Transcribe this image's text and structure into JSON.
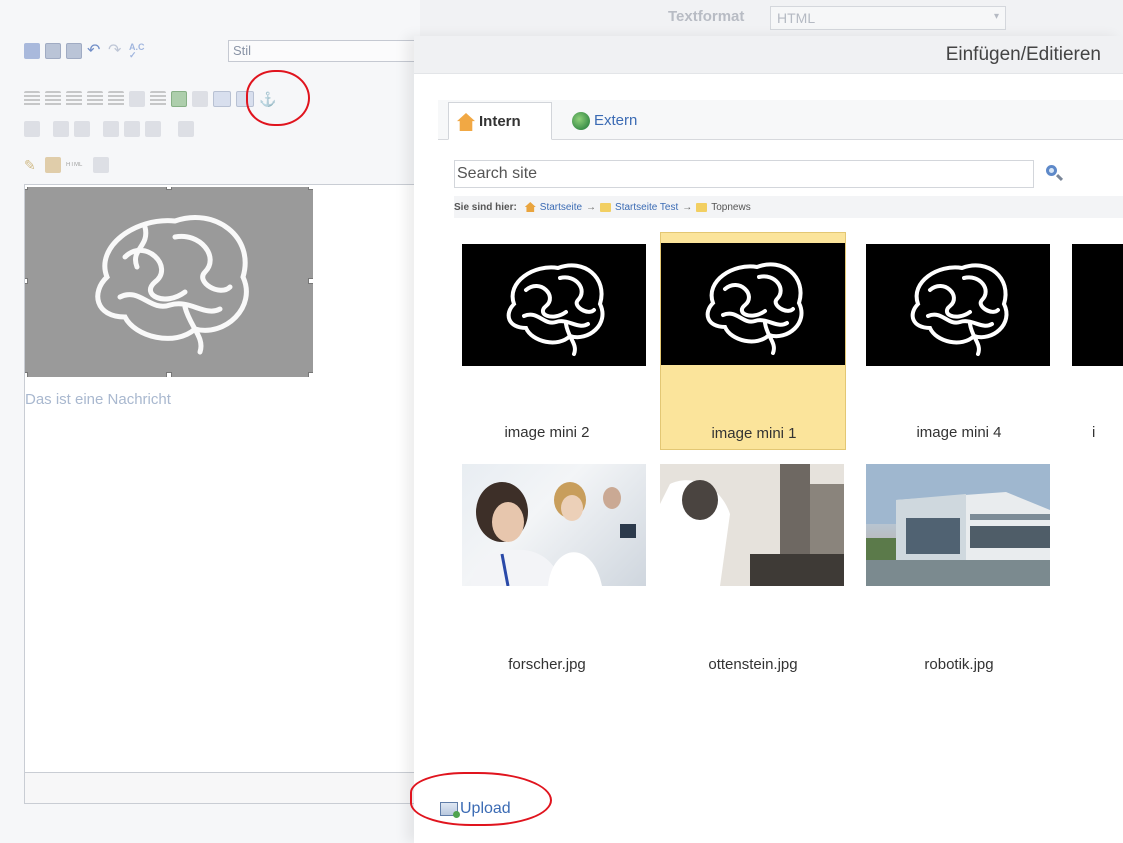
{
  "editor": {
    "style_select": {
      "value": "Stil"
    },
    "toolbar_icons": [
      "save-icon",
      "paste-text-icon",
      "paste-word-icon",
      "undo-icon",
      "redo-icon",
      "spellcheck-icon",
      "align-left-icon",
      "justify-icon",
      "bulleted-list-icon",
      "numbered-list-icon",
      "indent-icon",
      "outdent-icon",
      "blockquote-icon",
      "insert-image-icon",
      "flash-icon",
      "link-icon",
      "unlink-icon",
      "anchor-icon",
      "edit-icon",
      "table-icon",
      "subscript-icon",
      "superscript-icon",
      "spell-icon",
      "html-source-icon",
      "fullscreen-icon"
    ],
    "html_badge": "HTML",
    "content_caption": "Das ist eine Nachricht"
  },
  "textformat": {
    "label": "Textformat",
    "value": "HTML"
  },
  "dialog": {
    "title": "Einfügen/Editieren",
    "tabs": [
      {
        "label": "Intern",
        "icon": "home-icon",
        "active": true
      },
      {
        "label": "Extern",
        "icon": "globe-icon",
        "active": false
      }
    ],
    "search": {
      "placeholder": "Search site"
    },
    "breadcrumb": {
      "label": "Sie sind hier:",
      "items": [
        "Startseite",
        "Startseite Test",
        "Topnews"
      ]
    },
    "items": [
      {
        "caption": "image mini 2",
        "kind": "brain",
        "selected": false
      },
      {
        "caption": "image mini 1",
        "kind": "brain",
        "selected": true
      },
      {
        "caption": "image mini 4",
        "kind": "brain",
        "selected": false
      },
      {
        "caption": "i",
        "kind": "brain",
        "selected": false
      },
      {
        "caption": "forscher.jpg",
        "kind": "photo-forscher",
        "selected": false
      },
      {
        "caption": "ottenstein.jpg",
        "kind": "photo-ottenstein",
        "selected": false
      },
      {
        "caption": "robotik.jpg",
        "kind": "photo-robotik",
        "selected": false
      }
    ],
    "upload_label": "Upload"
  },
  "colors": {
    "annotation_red": "#e0141e",
    "selection_yellow": "#fbe49b",
    "link_blue": "#3b6bb4"
  }
}
